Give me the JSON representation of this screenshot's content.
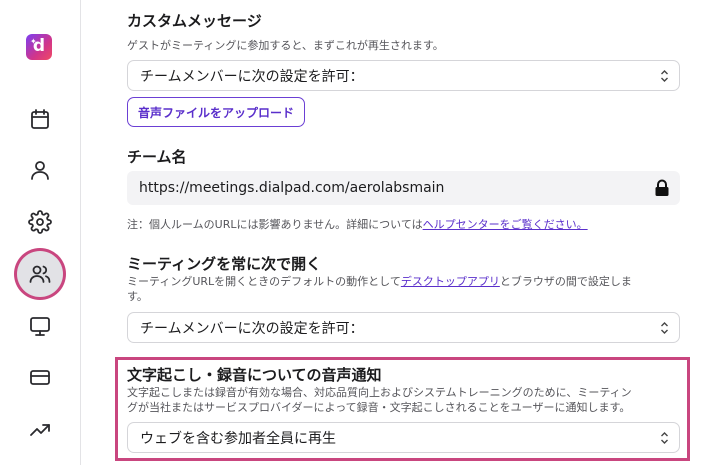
{
  "sidebar": {
    "logo_letter": "d",
    "items": [
      {
        "icon": "calendar-icon"
      },
      {
        "icon": "user-icon"
      },
      {
        "icon": "gear-icon"
      },
      {
        "icon": "users-icon",
        "active": true
      },
      {
        "icon": "monitor-icon"
      },
      {
        "icon": "credit-card-icon"
      },
      {
        "icon": "trending-up-icon"
      }
    ]
  },
  "custom_message": {
    "title": "カスタムメッセージ",
    "description": "ゲストがミーティングに参加すると、まずこれが再生されます。",
    "select_value": "チームメンバーに次の設定を許可：",
    "upload_label": "音声ファイルをアップロード"
  },
  "team_name": {
    "title": "チーム名",
    "url": "https://meetings.dialpad.com/aerolabsmain",
    "note_prefix": "注：個人ルームのURLには影響ありません。詳細については",
    "note_link": "ヘルプセンターをご覧ください。"
  },
  "open_meetings": {
    "title": "ミーティングを常に次で開く",
    "description_prefix": "ミーティングURLを開くときのデフォルトの動作として",
    "description_link": "デスクトップアプリ",
    "description_suffix": "とブラウザの間で設定しま",
    "description_line2": "す。",
    "select_value": "チームメンバーに次の設定を許可："
  },
  "transcription_notice": {
    "title": "文字起こし・録音についての音声通知",
    "description_line1": "文字起こしまたは録音が有効な場合、対応品質向上およびシステムトレーニングのために、ミーティン",
    "description_line2": "グが当社またはサービスプロバイダーによって録音・文字起こしされることをユーザーに通知します。",
    "select_value": "ウェブを含む参加者全員に再生"
  },
  "colors": {
    "accent": "#5a2fcb",
    "highlight": "#c9467f"
  }
}
